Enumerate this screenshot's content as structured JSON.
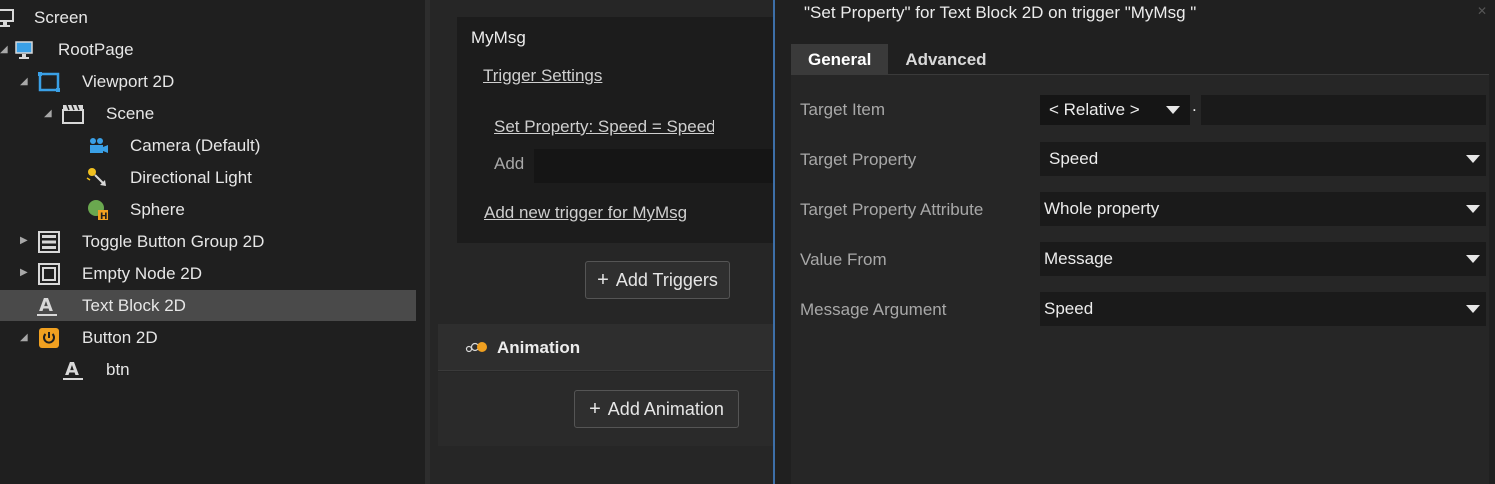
{
  "tree": {
    "items": [
      {
        "label": "Screen"
      },
      {
        "label": "RootPage"
      },
      {
        "label": "Viewport 2D"
      },
      {
        "label": "Scene"
      },
      {
        "label": "Camera (Default)"
      },
      {
        "label": "Directional Light"
      },
      {
        "label": "Sphere"
      },
      {
        "label": "Toggle Button Group 2D"
      },
      {
        "label": "Empty Node 2D"
      },
      {
        "label": "Text Block 2D"
      },
      {
        "label": "Button 2D"
      },
      {
        "label": "btn"
      }
    ],
    "selected": "Text Block 2D"
  },
  "triggers": {
    "message_name": "MyMsg",
    "trigger_settings_link": "Trigger Settings",
    "action_link": "Set Property: Speed = Speed",
    "add_label": "Add",
    "add_new_trigger_link": "Add new trigger for MyMsg",
    "add_triggers_button": "Add Triggers"
  },
  "animation": {
    "header": "Animation",
    "add_animation_button": "Add Animation"
  },
  "dialog": {
    "title": "\"Set Property\" for Text Block 2D on trigger \"MyMsg \"",
    "tabs": [
      {
        "label": "General"
      },
      {
        "label": "Advanced"
      }
    ],
    "active_tab": "General",
    "fields": {
      "target_item": {
        "label": "Target Item",
        "value": "< Relative >",
        "suffix": "."
      },
      "target_property": {
        "label": "Target Property",
        "value": "Speed"
      },
      "target_property_attribute": {
        "label": "Target Property Attribute",
        "value": "Whole property"
      },
      "value_from": {
        "label": "Value From",
        "value": "Message"
      },
      "message_argument": {
        "label": "Message Argument",
        "value": "Speed"
      }
    }
  },
  "colors": {
    "accent_border": "#3d6fa8",
    "icon_blue": "#3aa0e6",
    "icon_orange": "#f0a020",
    "selection": "#4a4a4a"
  }
}
